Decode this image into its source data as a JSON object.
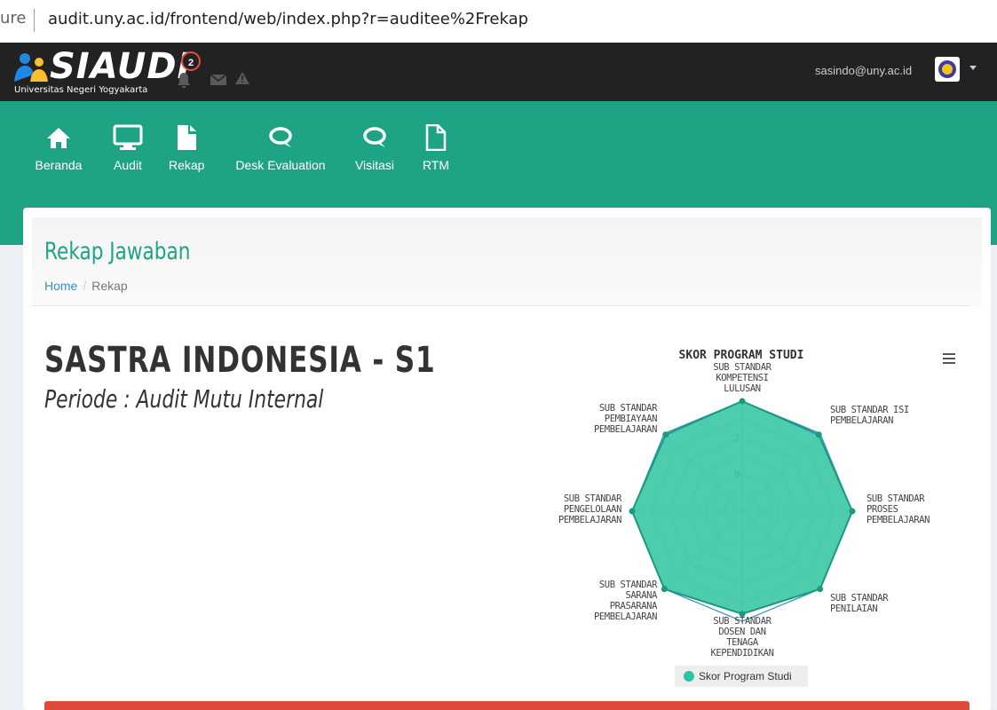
{
  "browser": {
    "url_prefix": "ure",
    "url": "audit.uny.ac.id/frontend/web/index.php?r=auditee%2Frekap"
  },
  "topbar": {
    "logo_text": "SIAUDI",
    "university": "Universitas Negeri Yogyakarta",
    "notification_count": "2",
    "user_email": "sasindo@uny.ac.id",
    "icons": [
      "bell-icon",
      "envelope-icon",
      "warning-icon"
    ]
  },
  "nav": {
    "items": [
      {
        "label": "Beranda",
        "icon": "home-icon"
      },
      {
        "label": "Audit",
        "icon": "monitor-icon"
      },
      {
        "label": "Rekap",
        "icon": "file-icon"
      },
      {
        "label": "Desk Evaluation",
        "icon": "chat-icon"
      },
      {
        "label": "Visitasi",
        "icon": "chat-icon"
      },
      {
        "label": "RTM",
        "icon": "file-outline-icon"
      }
    ]
  },
  "page": {
    "title": "Rekap Jawaban",
    "breadcrumb": {
      "home": "Home",
      "separator": "/",
      "current": "Rekap"
    },
    "program": "SASTRA INDONESIA - S1",
    "periode": "Periode : Audit Mutu Internal"
  },
  "colors": {
    "accent": "#1fa385",
    "series": "#2ec4a0",
    "series_line": "#1b9a80",
    "max_line": "#2a8fc4",
    "header": "#222222",
    "danger": "#dd4b39"
  },
  "chart_data": {
    "type": "radar",
    "title": "SKOR PROGRAM STUDI",
    "axis_ticks": [
      "0",
      "2"
    ],
    "rlim": [
      -2,
      4
    ],
    "categories": [
      [
        "SUB STANDAR",
        "KOMPETENSI",
        "LULUSAN"
      ],
      [
        "SUB STANDAR ISI",
        "PEMBELAJARAN"
      ],
      [
        "SUB STANDAR",
        "PROSES",
        "PEMBELAJARAN"
      ],
      [
        "SUB STANDAR",
        "PENILAIAN"
      ],
      [
        "SUB STANDAR",
        "DOSEN DAN",
        "TENAGA",
        "KEPENDIDIKAN"
      ],
      [
        "SUB STANDAR",
        "SARANA",
        "PRASARANA",
        "PEMBELAJARAN"
      ],
      [
        "SUB STANDAR",
        "PENGELOLAAN",
        "PEMBELAJARAN"
      ],
      [
        "SUB STANDAR",
        "PEMBIAYAAN",
        "PEMBELAJARAN"
      ]
    ],
    "series": [
      {
        "name": "Skor Program Studi",
        "values": [
          4,
          3.9,
          4,
          4,
          3.6,
          4,
          4,
          3.9
        ]
      }
    ],
    "max_values": [
      4,
      4,
      4,
      4,
      4,
      4,
      4,
      4
    ],
    "legend": "bottom-center"
  }
}
